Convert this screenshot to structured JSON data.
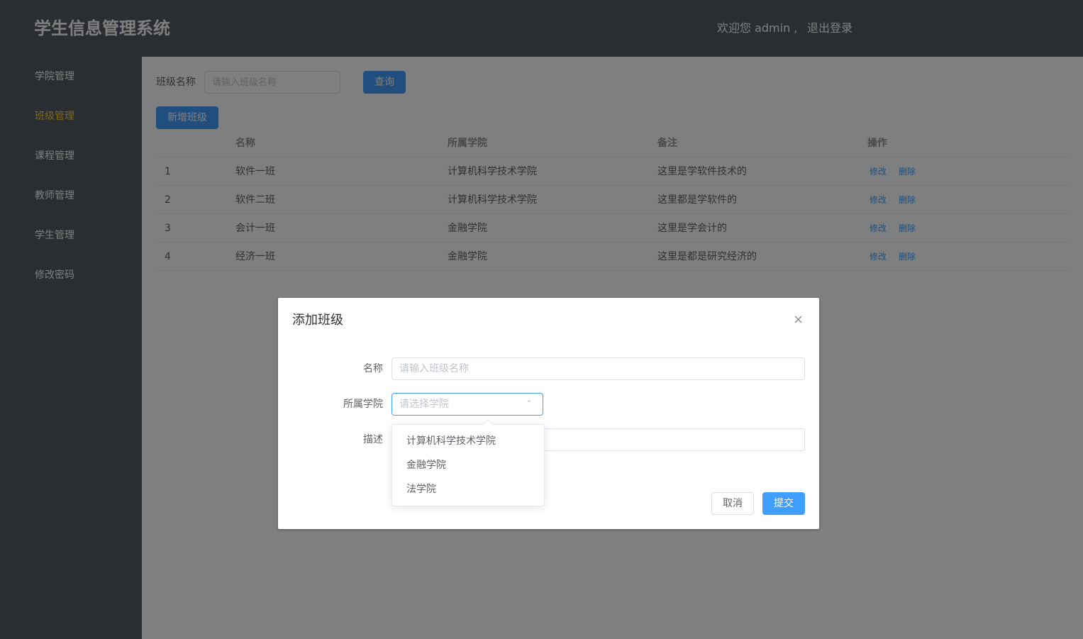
{
  "header": {
    "title": "学生信息管理系统",
    "welcome": "欢迎您 admin ,",
    "logout": "退出登录"
  },
  "sidebar": {
    "items": [
      {
        "label": "学院管理",
        "active": false
      },
      {
        "label": "班级管理",
        "active": true
      },
      {
        "label": "课程管理",
        "active": false
      },
      {
        "label": "教师管理",
        "active": false
      },
      {
        "label": "学生管理",
        "active": false
      },
      {
        "label": "修改密码",
        "active": false
      }
    ]
  },
  "search": {
    "label": "班级名称",
    "placeholder": "请输入班级名称",
    "query_button": "查询",
    "add_button": "新增班级"
  },
  "table": {
    "headers": [
      "",
      "名称",
      "所属学院",
      "备注",
      "操作"
    ],
    "rows": [
      {
        "id": "1",
        "name": "软件一班",
        "college": "计算机科学技术学院",
        "remark": "这里是学软件技术的"
      },
      {
        "id": "2",
        "name": "软件二班",
        "college": "计算机科学技术学院",
        "remark": "这里都是学软件的"
      },
      {
        "id": "3",
        "name": "会计一班",
        "college": "金融学院",
        "remark": "这里是学会计的"
      },
      {
        "id": "4",
        "name": "经济一班",
        "college": "金融学院",
        "remark": "这里是都是研究经济的"
      }
    ],
    "edit_label": "修改",
    "delete_label": "删除"
  },
  "dialog": {
    "title": "添加班级",
    "close_icon": "×",
    "name_label": "名称",
    "name_placeholder": "请输入班级名称",
    "college_label": "所属学院",
    "college_placeholder": "请选择学院",
    "desc_label": "描述",
    "cancel": "取消",
    "submit": "提交",
    "options": [
      "计算机科学技术学院",
      "金融学院",
      "法学院"
    ]
  },
  "colors": {
    "primary": "#409eff",
    "sidebar_bg": "#545c64",
    "active": "#ffd04b"
  }
}
